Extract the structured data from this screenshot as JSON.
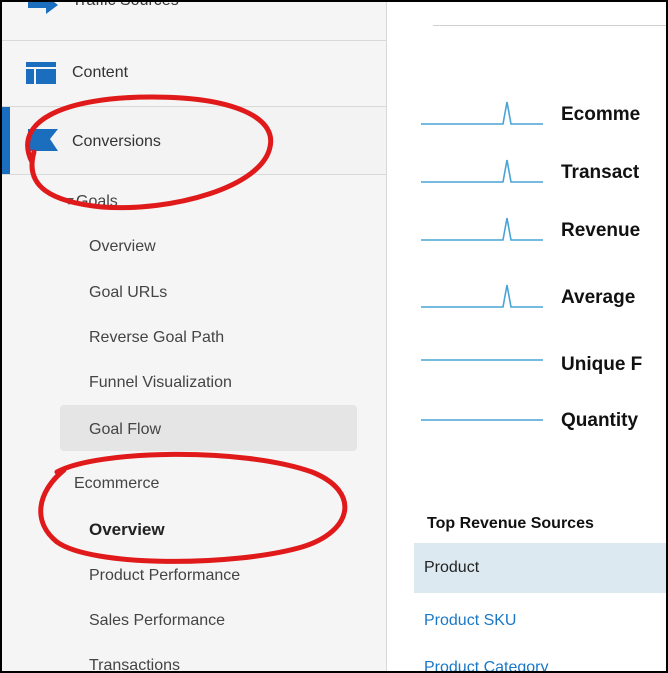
{
  "sidebar": {
    "traffic_sources": "Traffic Sources",
    "content": "Content",
    "conversions": "Conversions",
    "goals": {
      "label": "Goals",
      "items": [
        "Overview",
        "Goal URLs",
        "Reverse Goal Path",
        "Funnel Visualization",
        "Goal Flow"
      ]
    },
    "ecommerce": {
      "label": "Ecommerce",
      "items": [
        "Overview",
        "Product Performance",
        "Sales Performance",
        "Transactions"
      ]
    }
  },
  "main": {
    "metrics": [
      "Ecomme",
      "Transact",
      "Revenue",
      "Average",
      "Unique F",
      "Quantity"
    ],
    "sparkline_color": "#4aa3d6",
    "top_revenue_sources": {
      "title": "Top Revenue Sources",
      "rows": [
        "Product",
        "Product SKU",
        "Product Category"
      ]
    }
  },
  "annotation_color": "#e01a1a"
}
